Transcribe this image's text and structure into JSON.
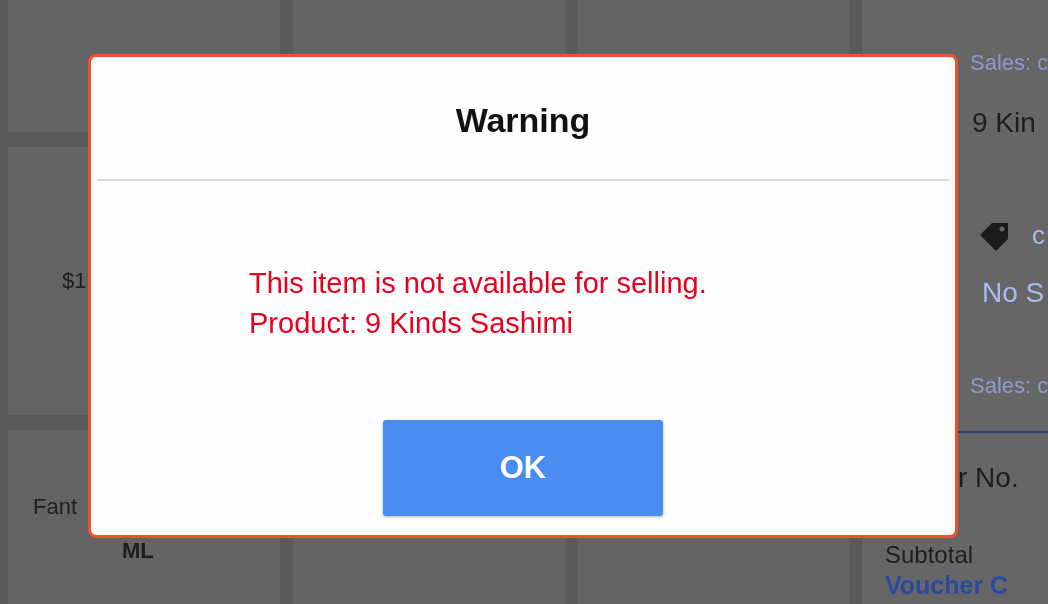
{
  "product_tiles": [
    {
      "price": "$1"
    },
    {
      "name_lines": [
        "Fant",
        "ML"
      ]
    }
  ],
  "order_panel": {
    "sales_label": "Sales: c",
    "item_name": "9 Kin",
    "discount_link": "c",
    "salesperson": "No S",
    "sales_label_2": "Sales: c",
    "order_no_label": "r No.",
    "subtotal_label": "Subtotal",
    "voucher_link": "Voucher C"
  },
  "dialog": {
    "title": "Warning",
    "message": [
      "This item is not available for selling.",
      "Product: 9 Kinds Sashimi"
    ],
    "button": "OK"
  }
}
